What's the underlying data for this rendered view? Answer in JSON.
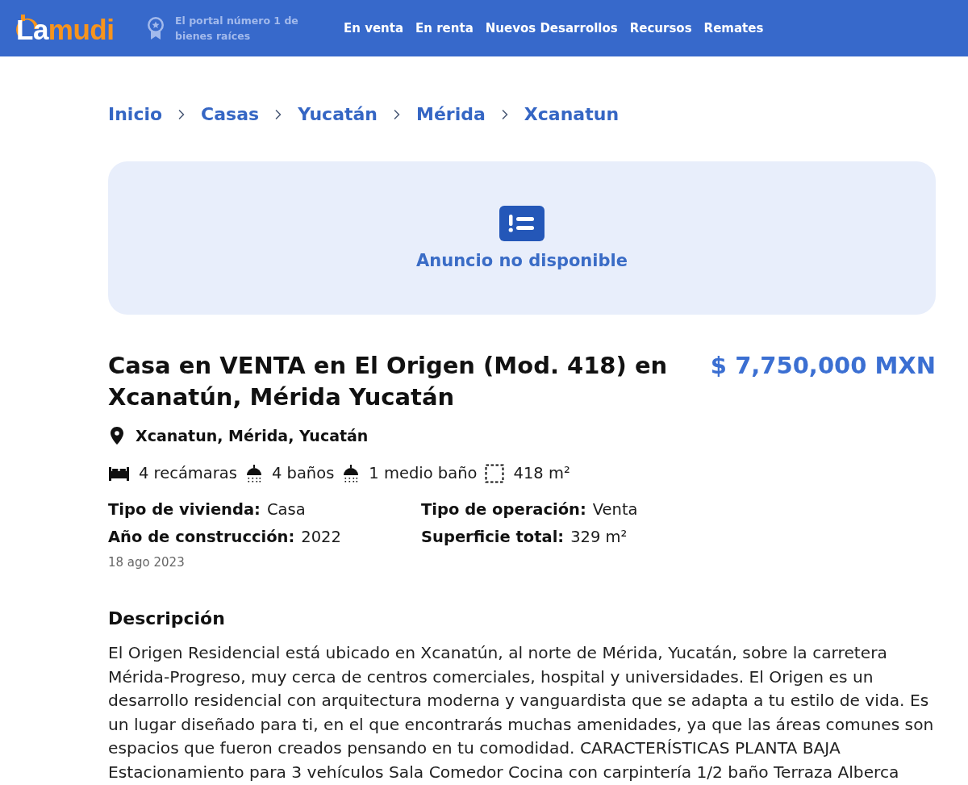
{
  "header": {
    "logo": [
      {
        "text": "La",
        "kind": "base"
      },
      {
        "text": "mudi",
        "kind": "accent"
      }
    ],
    "tagline": "El portal número 1 de bienes raíces",
    "nav": [
      "En venta",
      "En renta",
      "Nuevos Desarrollos",
      "Recursos",
      "Remates"
    ]
  },
  "breadcrumb": [
    "Inicio",
    "Casas",
    "Yucatán",
    "Mérida",
    "Xcanatun"
  ],
  "notice": {
    "message": "Anuncio no disponible"
  },
  "listing": {
    "title": "Casa en VENTA en El Origen (Mod. 418) en Xcanatún, Mérida Yucatán",
    "price": "$ 7,750,000 MXN",
    "location": "Xcanatun, Mérida, Yucatán",
    "features": [
      {
        "kind": "bedrooms",
        "text": "4 recámaras"
      },
      {
        "kind": "bathrooms",
        "text": "4 baños"
      },
      {
        "kind": "half_bathrooms",
        "text": "1 medio baño"
      },
      {
        "kind": "area",
        "text": "418 m²"
      }
    ],
    "attributes": [
      {
        "label": "Tipo de vivienda:",
        "value": "Casa"
      },
      {
        "label": "Tipo de operación:",
        "value": "Venta"
      },
      {
        "label": "Año de construcción:",
        "value": "2022"
      },
      {
        "label": "Superficie total:",
        "value": "329 m²"
      }
    ],
    "date": "18 ago 2023"
  },
  "description": {
    "heading": "Descripción",
    "text": "El Origen Residencial está ubicado en Xcanatún, al norte de Mérida, Yucatán, sobre la carretera Mérida-Progreso, muy cerca de centros comerciales, hospital y universidades. El Origen es un desarrollo residencial con arquitectura moderna y vanguardista que se adapta a tu estilo de vida. Es un lugar diseñado para ti, en el que encontrarás muchas amenidades, ya que las áreas comunes son espacios que fueron creados pensando en tu comodidad. CARACTERÍSTICAS PLANTA BAJA Estacionamiento para 3 vehículos Sala Comedor Cocina con carpintería 1/2 baño Terraza Alberca"
  }
}
